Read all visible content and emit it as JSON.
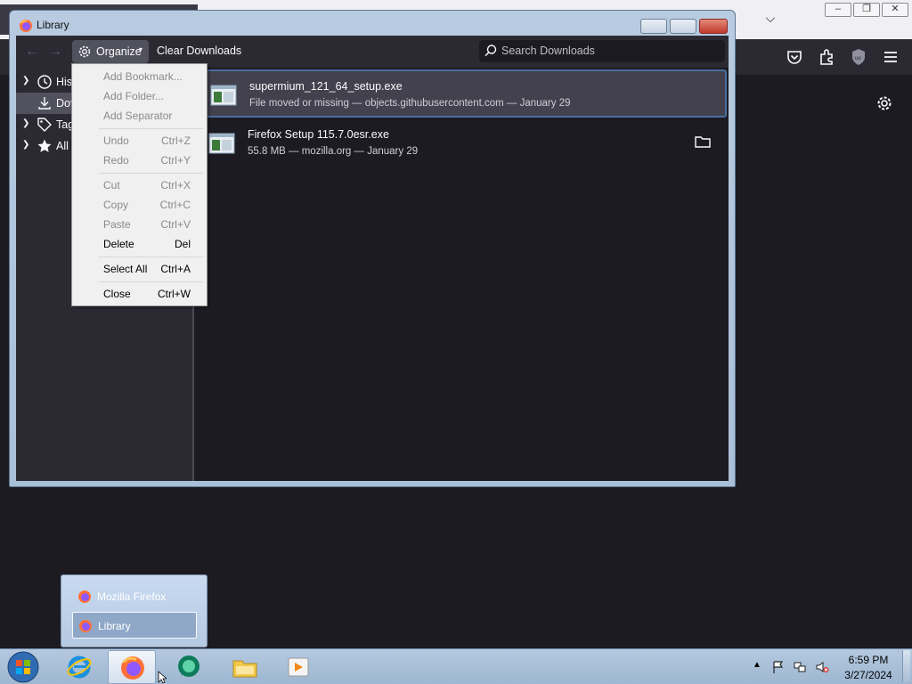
{
  "library_window": {
    "title": "Library",
    "toolbar": {
      "organize_label": "Organize",
      "clear_downloads_label": "Clear Downloads",
      "search_placeholder": "Search Downloads"
    },
    "sidebar": {
      "items": [
        {
          "label": "Hist",
          "icon": "clock-icon"
        },
        {
          "label": "Dov",
          "icon": "download-icon"
        },
        {
          "label": "Tag",
          "icon": "tag-icon"
        },
        {
          "label": "All",
          "icon": "star-icon"
        }
      ]
    },
    "downloads": [
      {
        "name": "supermium_121_64_setup.exe",
        "meta": "File moved or missing — objects.githubusercontent.com — January 29"
      },
      {
        "name": "Firefox Setup 115.7.0esr.exe",
        "meta": "55.8 MB — mozilla.org — January 29"
      }
    ]
  },
  "organize_menu": {
    "items": [
      {
        "label": "Add Bookmark...",
        "shortcut": ""
      },
      {
        "label": "Add Folder...",
        "shortcut": ""
      },
      {
        "label": "Add Separator",
        "shortcut": ""
      },
      {
        "label": "Undo",
        "shortcut": "Ctrl+Z"
      },
      {
        "label": "Redo",
        "shortcut": "Ctrl+Y"
      },
      {
        "label": "Cut",
        "shortcut": "Ctrl+X"
      },
      {
        "label": "Copy",
        "shortcut": "Ctrl+C"
      },
      {
        "label": "Paste",
        "shortcut": "Ctrl+V"
      },
      {
        "label": "Delete",
        "shortcut": "Del"
      },
      {
        "label": "Select All",
        "shortcut": "Ctrl+A"
      },
      {
        "label": "Close",
        "shortcut": "Ctrl+W"
      }
    ]
  },
  "taskbar_popup": {
    "items": [
      {
        "label": "Mozilla Firefox"
      },
      {
        "label": "Library"
      }
    ]
  },
  "taskbar": {
    "apps": [
      "internet-explorer-icon",
      "firefox-icon",
      "chat-icon",
      "file-explorer-icon",
      "media-player-icon"
    ],
    "clock_time": "6:59 PM",
    "clock_date": "3/27/2024"
  },
  "colors": {
    "accent_selected_row": "#42414d",
    "toolbar_bg": "#2b2a33",
    "content_bg": "#1c1b22",
    "taskbar": "#b4c9e0"
  }
}
